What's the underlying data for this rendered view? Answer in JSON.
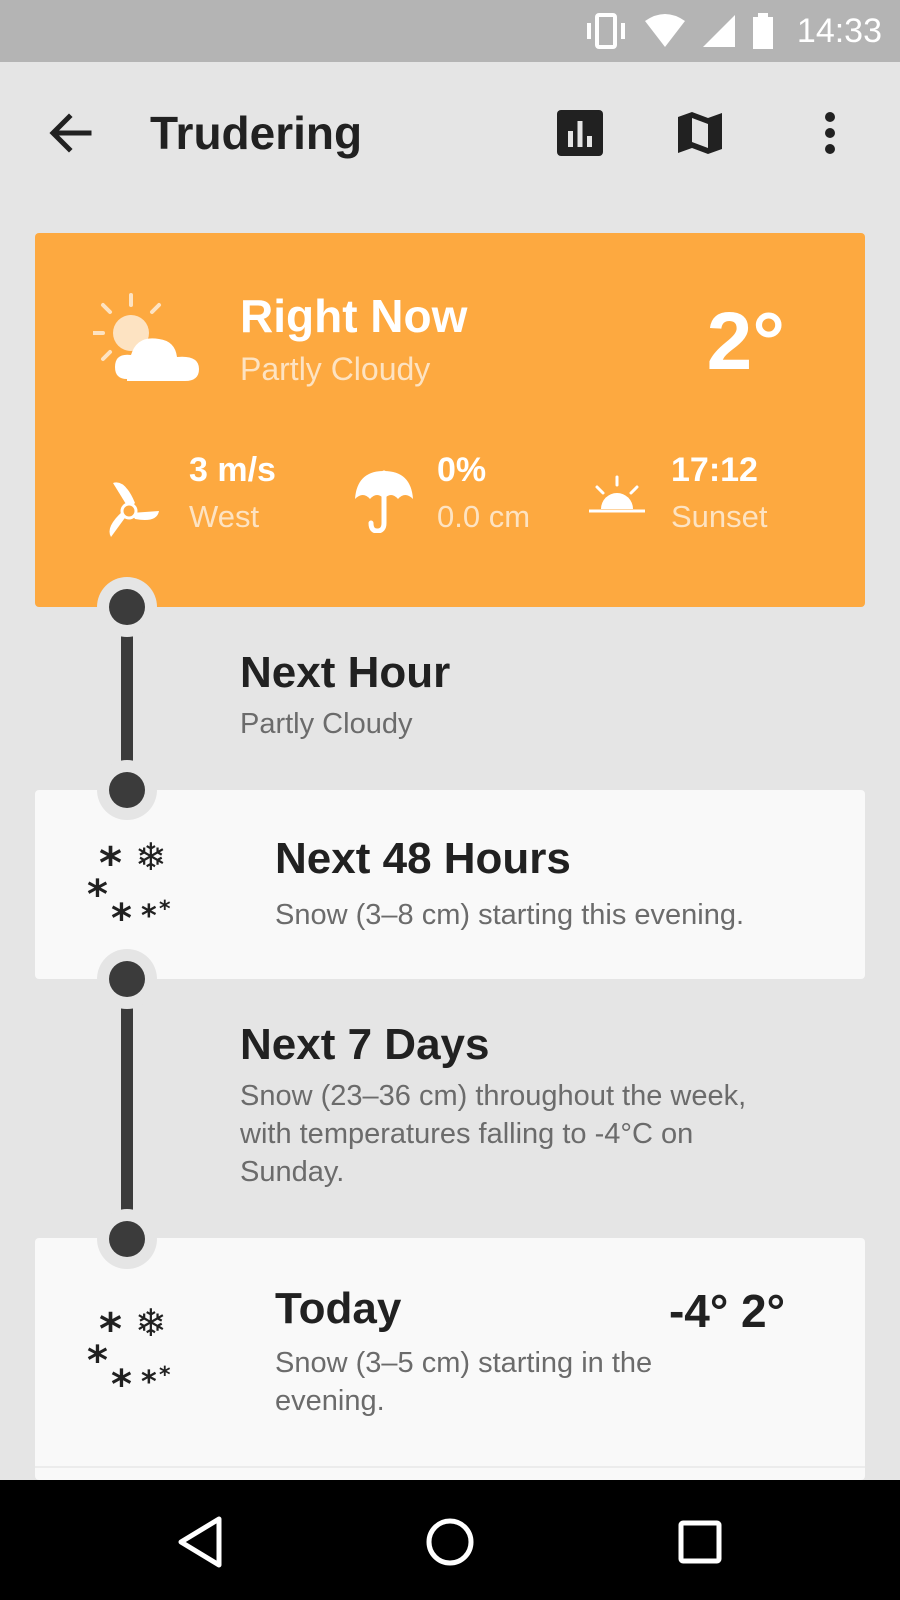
{
  "status_bar": {
    "time": "14:33"
  },
  "app_bar": {
    "title": "Trudering",
    "icons": [
      "back-arrow",
      "bar-chart",
      "map",
      "more-vert"
    ]
  },
  "right_now": {
    "title": "Right Now",
    "condition": "Partly Cloudy",
    "temperature": "2°",
    "wind": {
      "value": "3 m/s",
      "label": "West"
    },
    "precip": {
      "value": "0%",
      "label": "0.0 cm"
    },
    "sun": {
      "value": "17:12",
      "label": "Sunset"
    }
  },
  "next_hour": {
    "title": "Next Hour",
    "summary": "Partly Cloudy"
  },
  "next_48": {
    "title": "Next 48 Hours",
    "summary": "Snow (3–8 cm) starting this evening."
  },
  "next_7": {
    "title": "Next 7 Days",
    "line1": "Snow (23–36 cm) throughout the week,",
    "line2": "with temperatures falling to -4°C on",
    "line3": "Sunday."
  },
  "today": {
    "title": "Today",
    "line1": "Snow (3–5 cm) starting in the",
    "line2": "evening.",
    "temp_low": "-4°",
    "temp_high": "2°"
  },
  "colors": {
    "accent": "#fda940",
    "background": "#e5e5e5",
    "card": "#f9f9f9",
    "timeline": "#3b3b3b"
  }
}
